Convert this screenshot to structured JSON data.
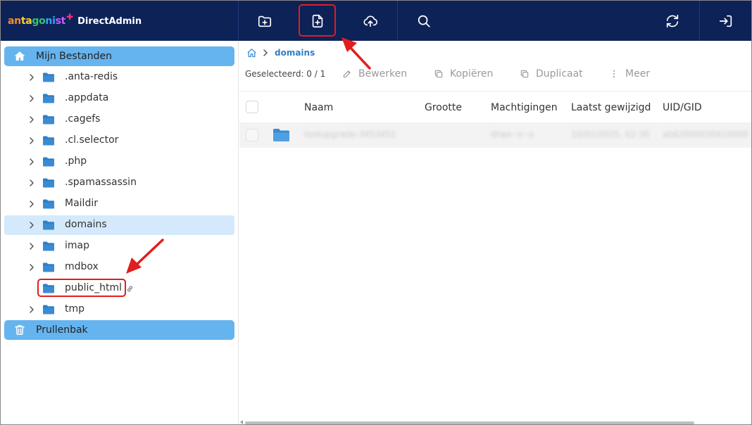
{
  "app": {
    "logo_text": "antagonist",
    "product": "DirectAdmin"
  },
  "toolbar": {
    "new_folder": "folder-plus-icon",
    "new_file": "file-plus-icon",
    "upload": "cloud-upload-icon",
    "search": "search-icon",
    "refresh": "refresh-icon",
    "logout": "logout-icon"
  },
  "sidebar": {
    "root_label": "Mijn Bestanden",
    "items": [
      {
        "label": ".anta-redis",
        "expandable": true
      },
      {
        "label": ".appdata",
        "expandable": true
      },
      {
        "label": ".cagefs",
        "expandable": true
      },
      {
        "label": ".cl.selector",
        "expandable": true
      },
      {
        "label": ".php",
        "expandable": true
      },
      {
        "label": ".spamassassin",
        "expandable": true
      },
      {
        "label": "Maildir",
        "expandable": true
      },
      {
        "label": "domains",
        "expandable": true,
        "selected": true
      },
      {
        "label": "imap",
        "expandable": true
      },
      {
        "label": "mdbox",
        "expandable": true
      },
      {
        "label": "public_html",
        "expandable": false,
        "symlink": true
      },
      {
        "label": "tmp",
        "expandable": true
      }
    ],
    "trash_label": "Prullenbak"
  },
  "main": {
    "breadcrumb": {
      "current": "domains"
    },
    "selection": "Geselecteerd: 0 / 1",
    "actions": {
      "edit": "Bewerken",
      "copy": "Kopiëren",
      "duplicate": "Duplicaat",
      "more": "Meer"
    },
    "columns": {
      "name": "Naam",
      "size": "Grootte",
      "permissions": "Machtigingen",
      "modified": "Laatst gewijzigd",
      "uid": "UID/GID"
    },
    "rows": [
      {
        "name": "testupgrade-3453451",
        "permissions": "drwx--x--x",
        "modified": "10/02/2025, 02:30",
        "uid": "ab62000030410000"
      }
    ]
  },
  "colors": {
    "topbar": "#0d2257",
    "root_item": "#66b4ef",
    "selected_item": "#d4e9fb",
    "folder": "#3b8bd3",
    "annotation": "#e11d1d"
  }
}
